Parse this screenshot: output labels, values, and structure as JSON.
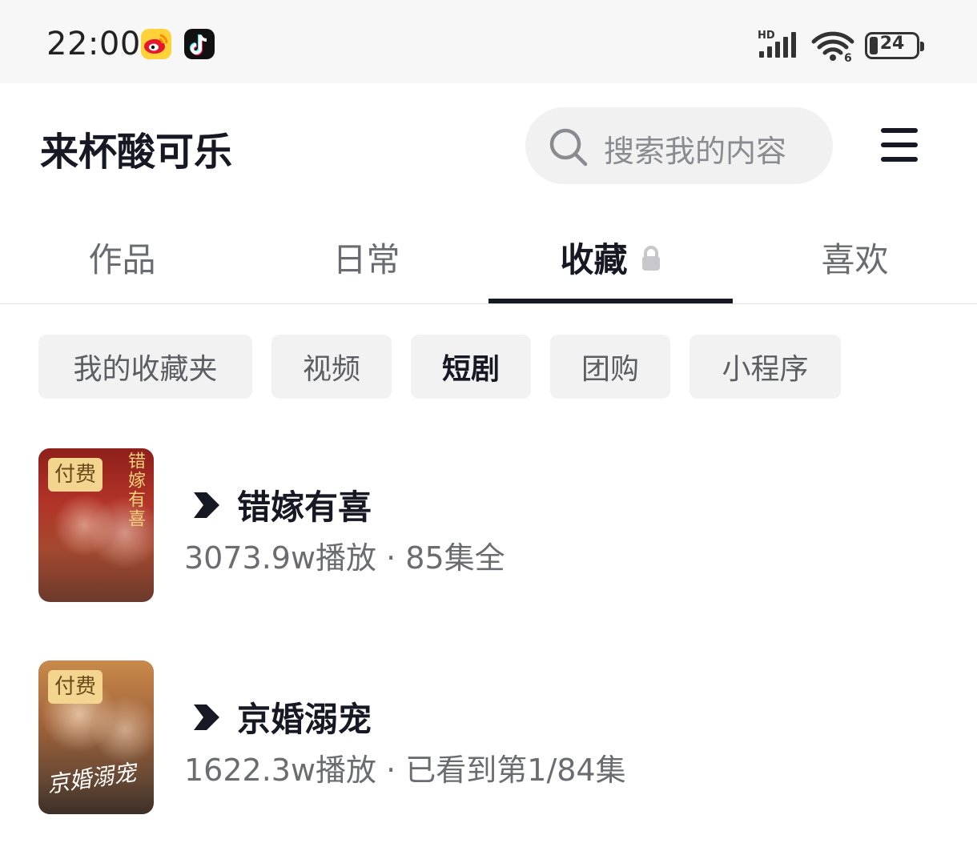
{
  "status_bar": {
    "time": "22:00",
    "app_icons": [
      "weibo-icon",
      "douyin-icon"
    ],
    "signal_label": "HD",
    "battery": "24"
  },
  "header": {
    "profile_name": "来杯酸可乐",
    "search_placeholder": "搜索我的内容",
    "menu_icon": "menu-icon"
  },
  "tabs": [
    {
      "label": "作品",
      "active": false
    },
    {
      "label": "日常",
      "active": false
    },
    {
      "label": "收藏",
      "active": true,
      "locked": true
    },
    {
      "label": "喜欢",
      "active": false
    }
  ],
  "filter_chips": [
    {
      "label": "我的收藏夹",
      "active": false
    },
    {
      "label": "视频",
      "active": false
    },
    {
      "label": "短剧",
      "active": true
    },
    {
      "label": "团购",
      "active": false
    },
    {
      "label": "小程序",
      "active": false
    }
  ],
  "items": [
    {
      "badge": "付费",
      "poster_text": "错嫁有喜",
      "title": "错嫁有喜",
      "meta": "3073.9w播放 · 85集全"
    },
    {
      "badge": "付费",
      "poster_text": "京婚溺宠",
      "title": "京婚溺宠",
      "meta": "1622.3w播放 · 已看到第1/84集"
    }
  ],
  "colors": {
    "text_primary": "#161823",
    "text_secondary": "#6b6c72",
    "chip_bg": "#f2f2f3",
    "badge_bg": "#f3d58f"
  }
}
